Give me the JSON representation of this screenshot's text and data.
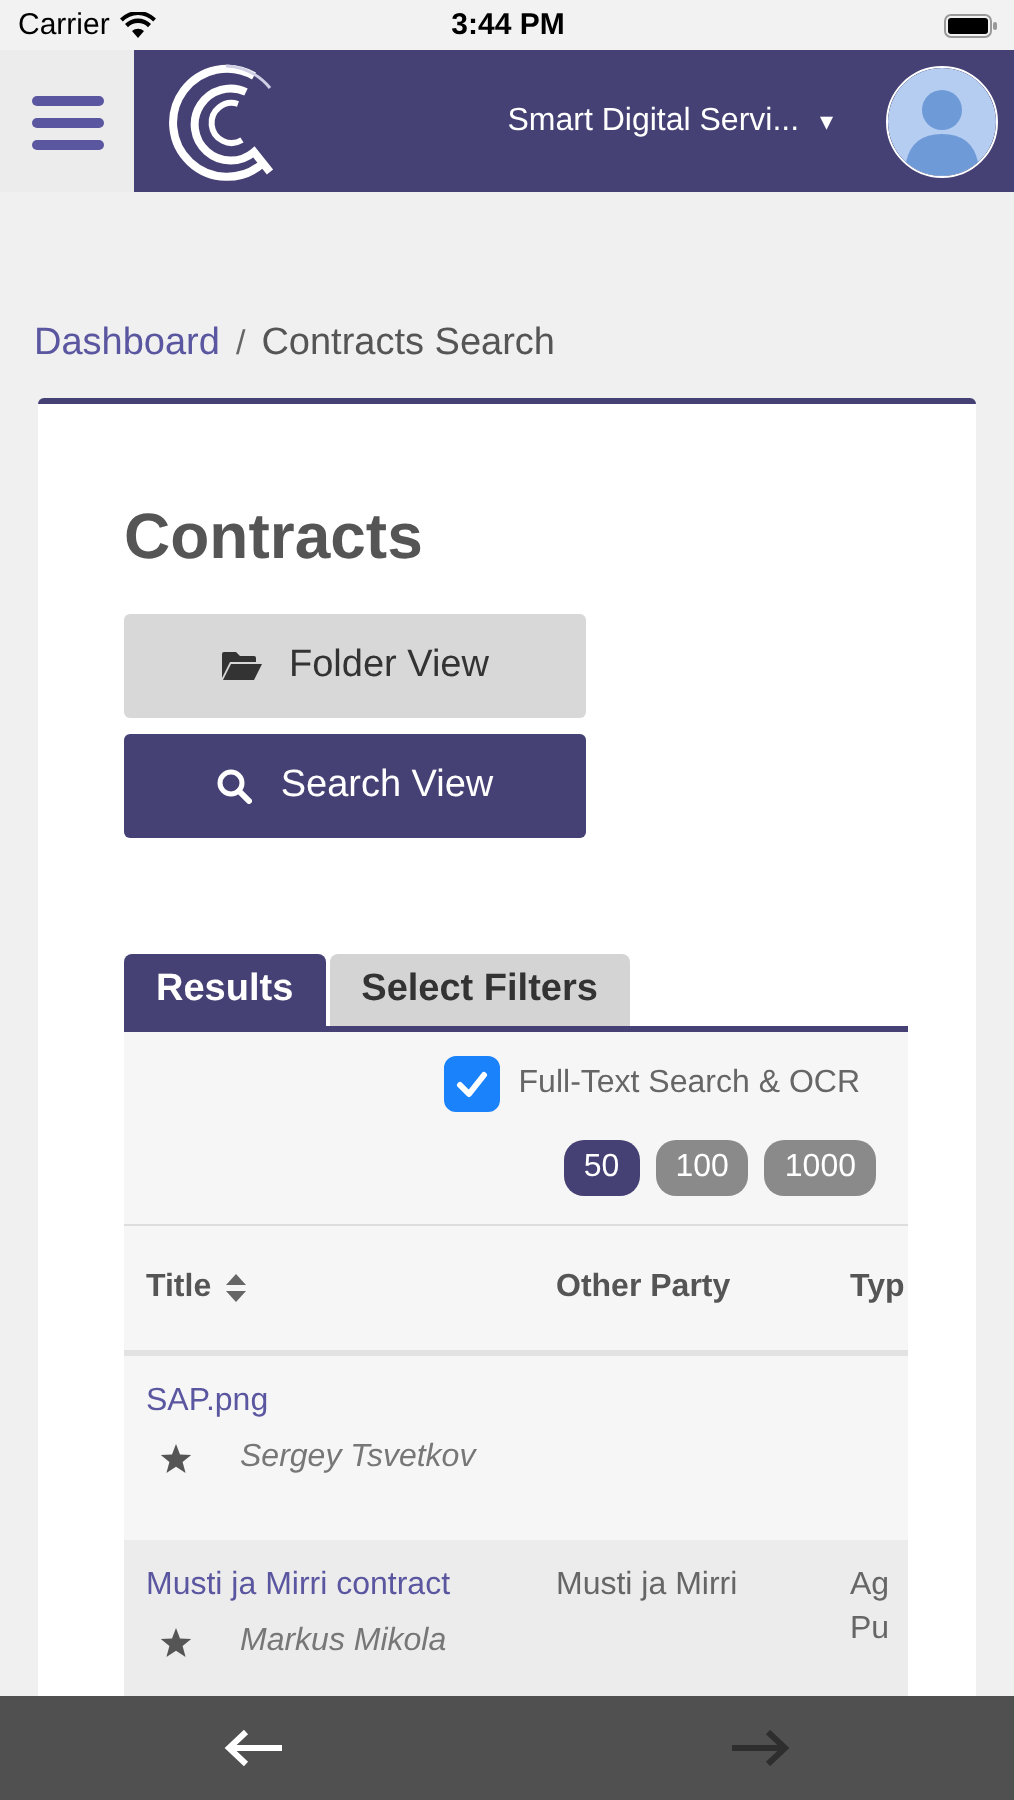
{
  "status_bar": {
    "carrier": "Carrier",
    "time": "3:44 PM"
  },
  "header": {
    "account": "Smart Digital Servi...",
    "account_caret": "▾"
  },
  "breadcrumb": [
    {
      "label": "Dashboard",
      "kind": "link"
    },
    {
      "label": "Contracts Search",
      "kind": "current"
    }
  ],
  "breadcrumb_separator": "/",
  "page_title": "Contracts",
  "view_buttons": [
    {
      "label": "Folder View",
      "kind": "folder",
      "selected": false
    },
    {
      "label": "Search View",
      "kind": "search",
      "selected": true
    }
  ],
  "tabs": [
    {
      "label": "Results",
      "selected": true
    },
    {
      "label": "Select Filters",
      "selected": false
    }
  ],
  "full_text_search": {
    "label": "Full-Text Search & OCR",
    "checked": true
  },
  "page_sizes": [
    {
      "label": "50",
      "selected": true
    },
    {
      "label": "100",
      "selected": false
    },
    {
      "label": "1000",
      "selected": false
    }
  ],
  "table": {
    "columns": [
      "Title",
      "Other Party",
      "Typ"
    ],
    "rows": [
      {
        "title": "SAP.png",
        "owner": "Sergey Tsvetkov",
        "other_party": "",
        "column_3": []
      },
      {
        "title": "Musti ja Mirri contract",
        "owner": "Markus Mikola",
        "other_party": "Musti ja Mirri",
        "column_3": [
          "Ag",
          "Pu"
        ]
      }
    ]
  },
  "bottom_nav": {
    "back_disabled": false,
    "forward_disabled": true
  }
}
